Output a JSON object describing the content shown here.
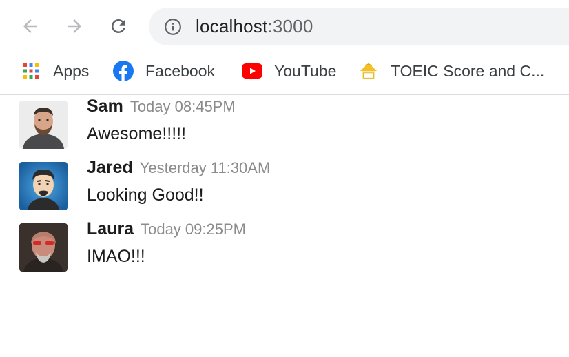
{
  "browser": {
    "url_host": "localhost",
    "url_port": ":3000",
    "bookmarks": [
      {
        "label": "Apps",
        "icon": "apps-grid-icon"
      },
      {
        "label": "Facebook",
        "icon": "facebook-icon"
      },
      {
        "label": "YouTube",
        "icon": "youtube-icon"
      },
      {
        "label": "TOEIC Score and C...",
        "icon": "toeic-icon"
      }
    ]
  },
  "messages": [
    {
      "author": "Sam",
      "time": "Today 08:45PM",
      "text": "Awesome!!!!!"
    },
    {
      "author": "Jared",
      "time": "Yesterday 11:30AM",
      "text": "Looking Good!!"
    },
    {
      "author": "Laura",
      "time": "Today 09:25PM",
      "text": "IMAO!!!"
    }
  ],
  "colors": {
    "omnibox_bg": "#f1f3f4",
    "facebook_blue": "#1877f2",
    "youtube_red": "#ff0000",
    "timestamp_gray": "#8b8b8b"
  }
}
